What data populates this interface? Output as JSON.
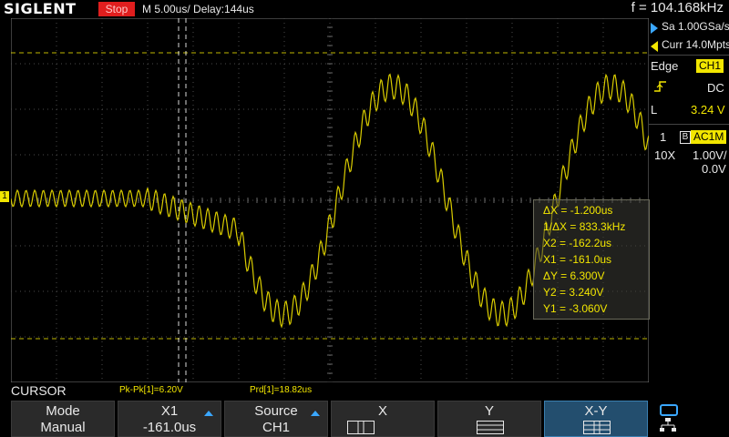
{
  "header": {
    "brand": "SIGLENT",
    "run_state": "Stop",
    "timebase": "M 5.00us/",
    "delay": "Delay:144us",
    "frequency": "f = 104.168kHz"
  },
  "acquisition": {
    "sample_rate": "Sa 1.00GSa/s",
    "memory": "Curr 14.0Mpts"
  },
  "trigger": {
    "type": "Edge",
    "source": "CH1",
    "coupling": "DC",
    "level_label": "L",
    "level": "3.24 V"
  },
  "channel": {
    "number": "1",
    "bandwidth_mark": "B",
    "coupling": "AC1M",
    "probe": "10X",
    "scale": "1.00V/",
    "offset": "0.0V",
    "marker": "1"
  },
  "cursor_readout": {
    "dx": "ΔX = -1.200us",
    "inv_dx": "1/ΔX = 833.3kHz",
    "x2": "X2 = -162.2us",
    "x1": "X1 = -161.0us",
    "dy": "ΔY = 6.300V",
    "y2": "Y2 = 3.240V",
    "y1": "Y1 = -3.060V"
  },
  "status": {
    "mode_label": "CURSOR",
    "measurement_1": "Pk-Pk[1]=6.20V",
    "measurement_2": "Prd[1]=18.82us"
  },
  "softkeys": [
    {
      "top": "Mode",
      "bottom": "Manual"
    },
    {
      "top": "X1",
      "bottom": "-161.0us"
    },
    {
      "top": "Source",
      "bottom": "CH1"
    },
    {
      "top": "X",
      "bottom": ""
    },
    {
      "top": "Y",
      "bottom": ""
    },
    {
      "top": "X-Y",
      "bottom": ""
    }
  ],
  "colors": {
    "trace": "#f2e600",
    "stop": "#e01e1e",
    "selected": "#234e6e"
  },
  "icons": {
    "trigger_edge": "rising-edge-icon",
    "adjust": "knob-arrow-icon",
    "network": "network-icon"
  }
}
